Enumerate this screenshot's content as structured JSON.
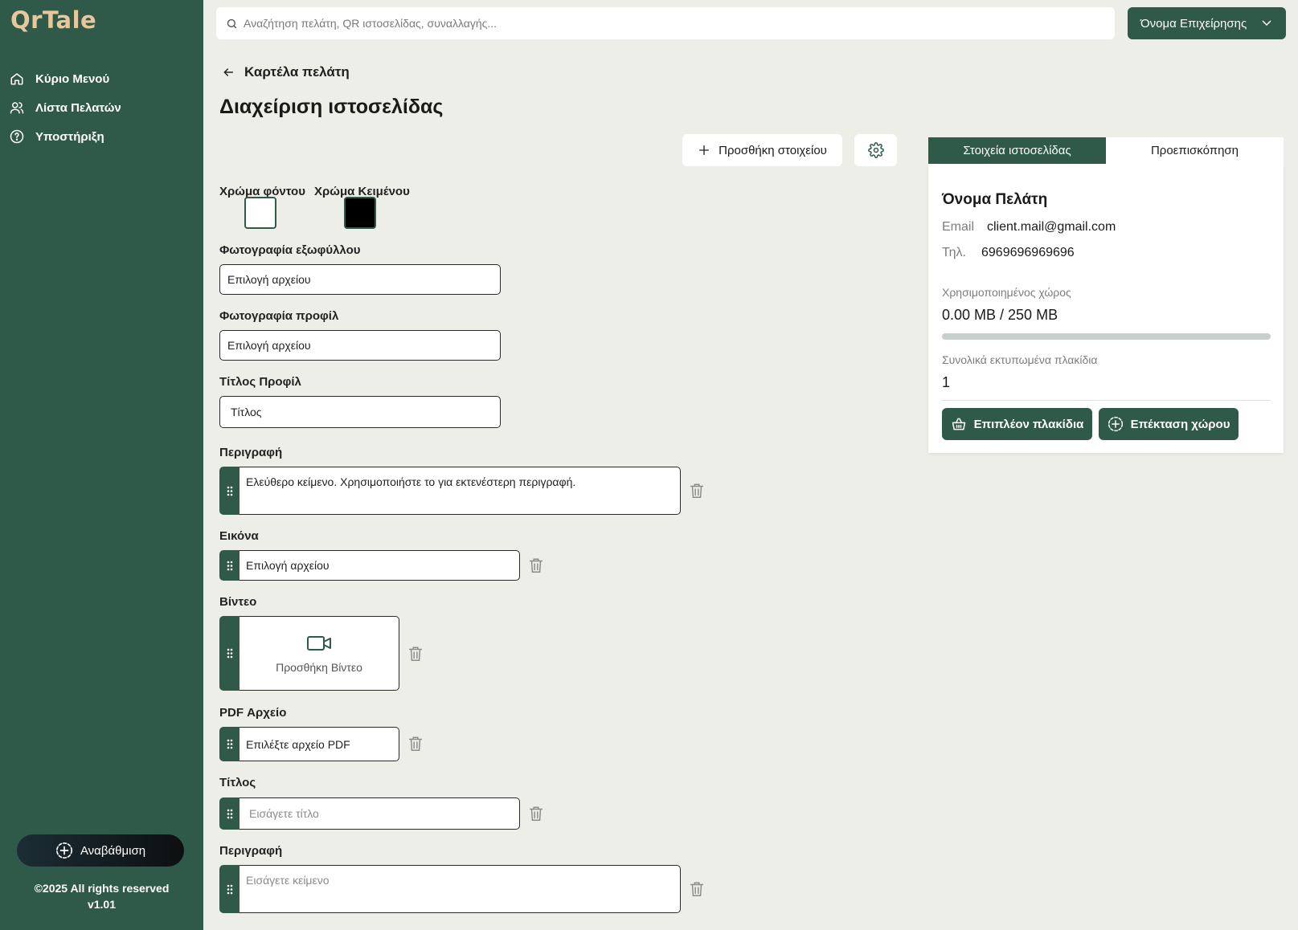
{
  "app": {
    "logo": "QrTale"
  },
  "sidebar": {
    "items": [
      {
        "label": "Κύριο Μενού",
        "icon": "home-icon"
      },
      {
        "label": "Λίστα Πελατών",
        "icon": "users-icon"
      },
      {
        "label": "Υποστήριξη",
        "icon": "help-circle-icon"
      }
    ],
    "upgrade_label": "Αναβάθμιση",
    "copyright": "©2025 All rights reserved",
    "version": "v1.01"
  },
  "topbar": {
    "search_placeholder": "Αναζήτηση πελάτη, QR ιστοσελίδας, συναλλαγής...",
    "business_label": "Όνομα Επιχείρησης"
  },
  "header": {
    "back_label": "Καρτέλα πελάτη",
    "page_title": "Διαχείριση ιστοσελίδας",
    "add_element_label": "Προσθήκη στοιχείου"
  },
  "editor": {
    "bg_color_label": "Χρώμα φόντου",
    "bg_color": "#ffffff",
    "text_color_label": "Χρώμα Κειμένου",
    "text_color": "#000000",
    "cover_label": "Φωτογραφία εξωφύλλου",
    "cover_value": "Επιλογή αρχείου",
    "profile_label": "Φωτογραφία προφίλ",
    "profile_value": "Επιλογή αρχείου",
    "profile_title_label": "Τίτλος Προφίλ",
    "profile_title_value": "Τίτλος",
    "blocks": {
      "desc1_label": "Περιγραφή",
      "desc1_value": "Ελεύθερο κείμενο. Χρησιμοποιήστε το για εκτενέστερη περιγραφή.",
      "image_label": "Εικόνα",
      "image_value": "Επιλογή αρχείου",
      "video_label": "Βίντεο",
      "video_add": "Προσθήκη Βίντεο",
      "pdf_label": "PDF Αρχείο",
      "pdf_value": "Επιλέξτε αρχείο PDF",
      "title_label": "Τίτλος",
      "title_placeholder": "Εισάγετε τίτλο",
      "desc2_label": "Περιγραφή",
      "desc2_placeholder": "Εισάγετε κείμενο"
    }
  },
  "panel": {
    "tabs": [
      "Στοιχεία ιστοσελίδας",
      "Προεπισκόπηση"
    ],
    "client_name": "Όνομα Πελάτη",
    "email_label": "Email",
    "email": "client.mail@gmail.com",
    "phone_label": "Τηλ.",
    "phone": "6969696969696",
    "storage_label": "Χρησιμοποιημένος χώρος",
    "storage_value": "0.00 MB / 250 MB",
    "storage_fraction": 0,
    "tiles_label": "Συνολικά εκτυπωμένα πλακίδια",
    "tiles_value": "1",
    "more_tiles_label": "Επιπλέον πλακίδια",
    "expand_label": "Επέκταση χώρου"
  },
  "colors": {
    "primary": "#2f5a4a",
    "background": "#eeeee9",
    "logo": "#e7c79b"
  }
}
